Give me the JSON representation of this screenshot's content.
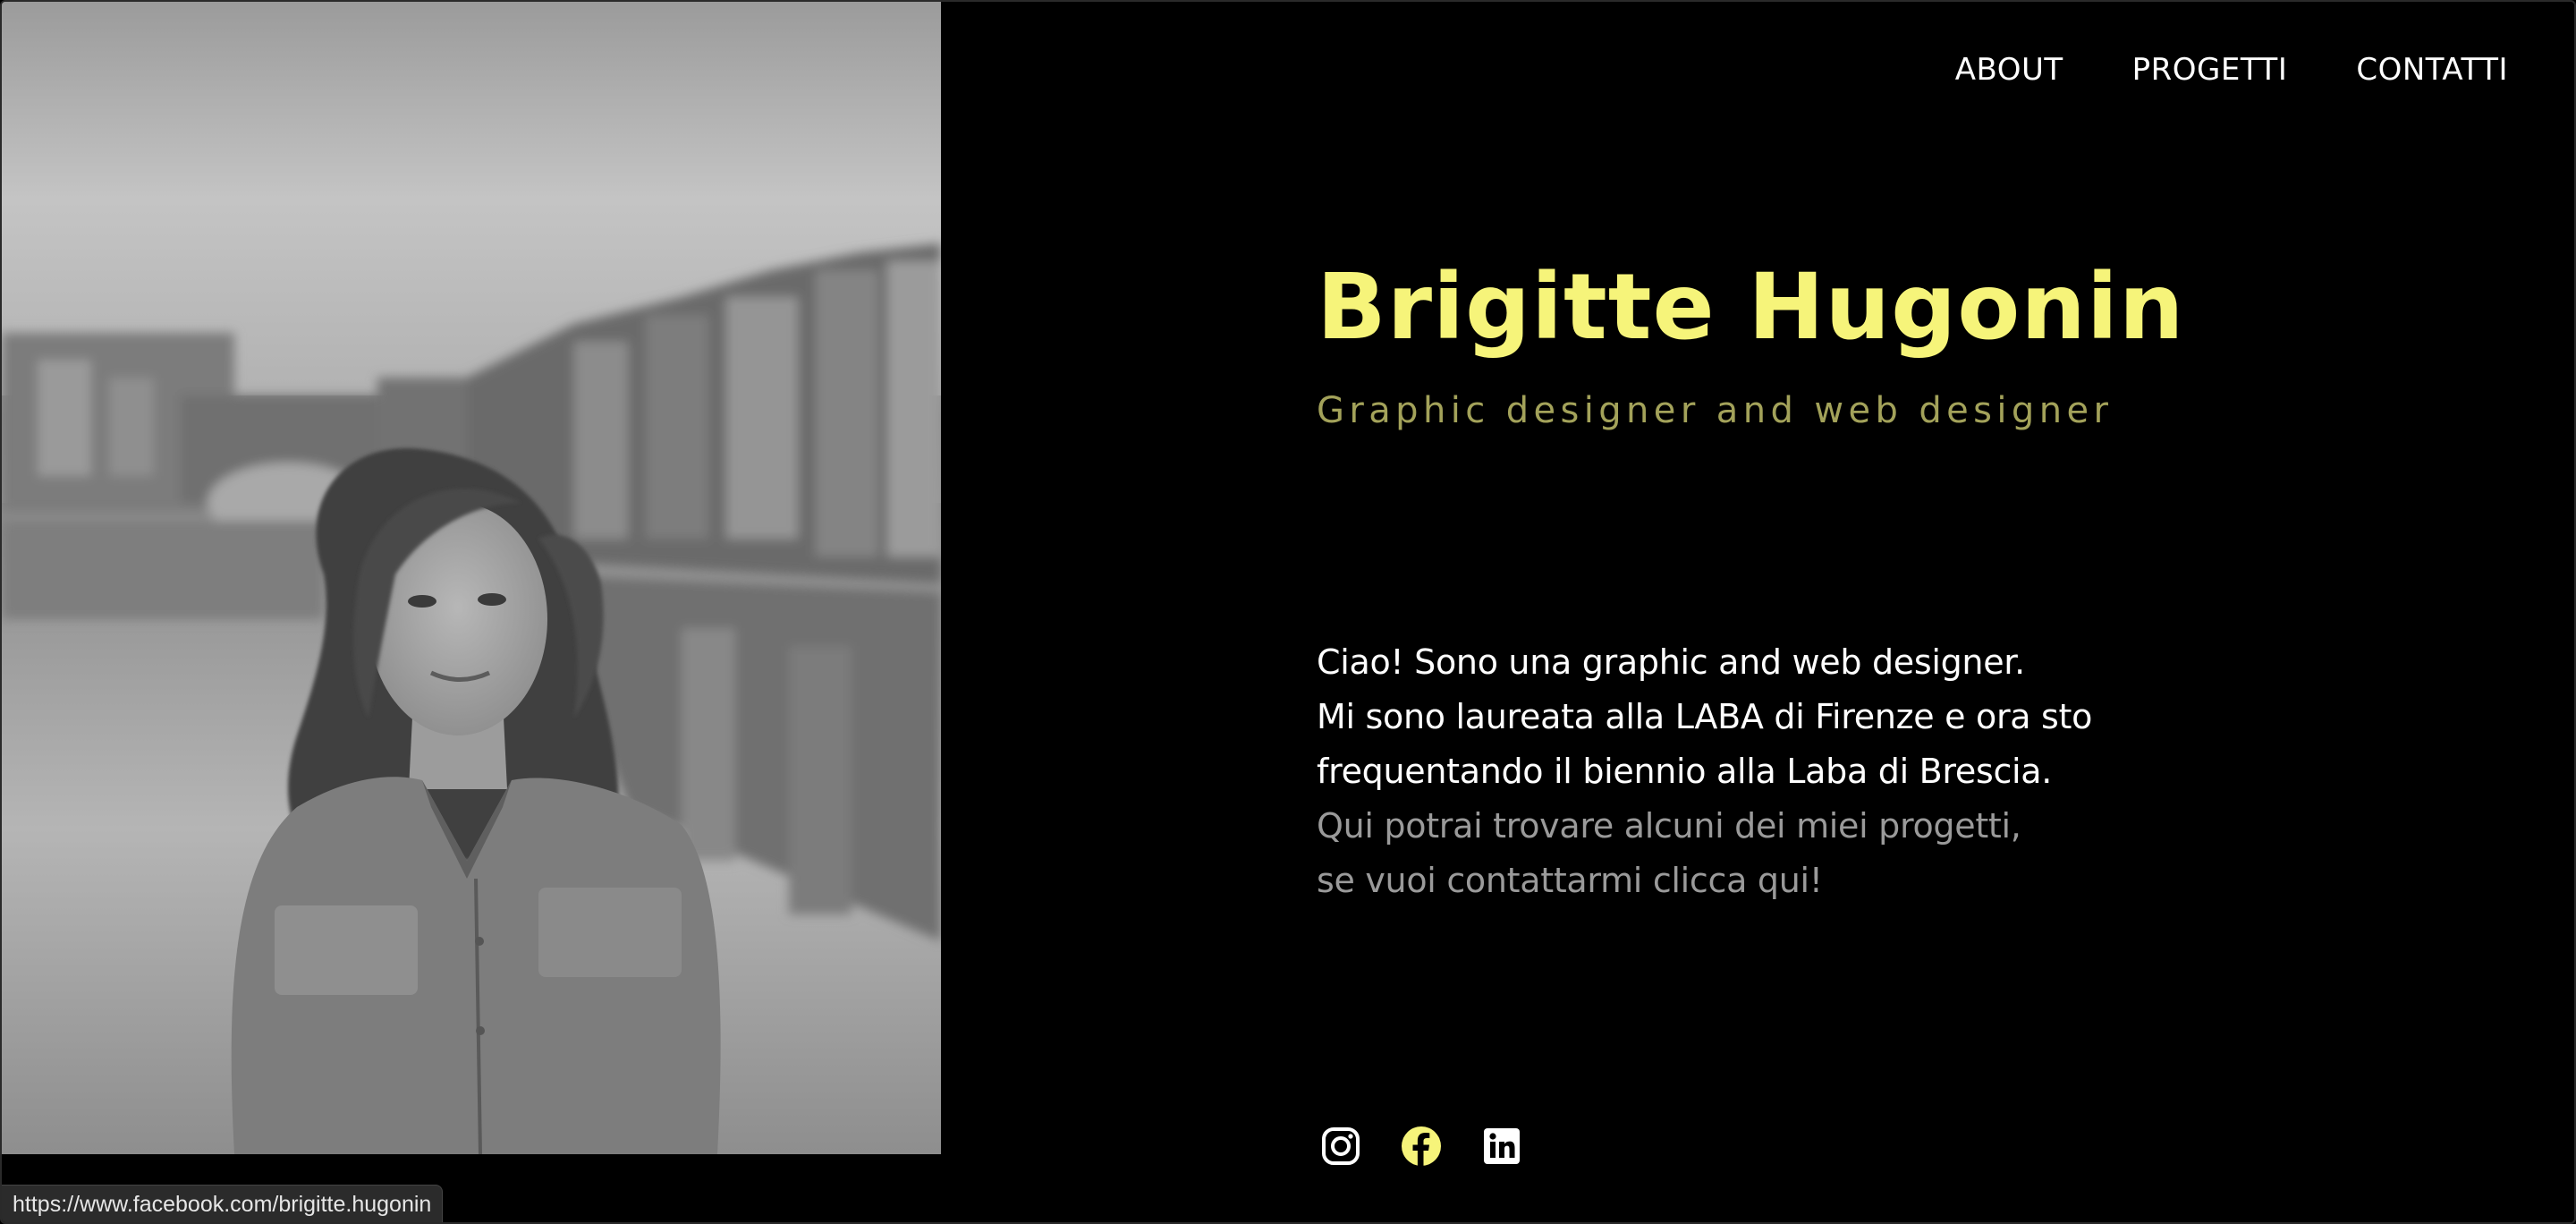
{
  "nav": {
    "items": [
      {
        "label": "ABOUT"
      },
      {
        "label": "PROGETTI"
      },
      {
        "label": "CONTATTI"
      }
    ]
  },
  "hero": {
    "name": "Brigitte Hugonin",
    "subtitle": "Graphic designer and web designer"
  },
  "bio": {
    "lines_white": [
      "Ciao! Sono una graphic and web designer.",
      "Mi sono laureata alla LABA di Firenze e ora sto",
      "frequentando il biennio alla Laba di Brescia."
    ],
    "lines_gray": [
      "Qui potrai trovare alcuni dei miei progetti,",
      "se vuoi contattarmi clicca qui!"
    ]
  },
  "socials": [
    {
      "icon": "instagram-icon",
      "color": "#ffffff"
    },
    {
      "icon": "facebook-icon",
      "color": "#f6f47a"
    },
    {
      "icon": "linkedin-icon",
      "color": "#ffffff"
    }
  ],
  "status_url": "https://www.facebook.com/brigitte.hugonin",
  "colors": {
    "accent": "#f6f47a",
    "subtitle": "#a3a25a",
    "background": "#000000",
    "muted_text": "#9a9a9a"
  }
}
